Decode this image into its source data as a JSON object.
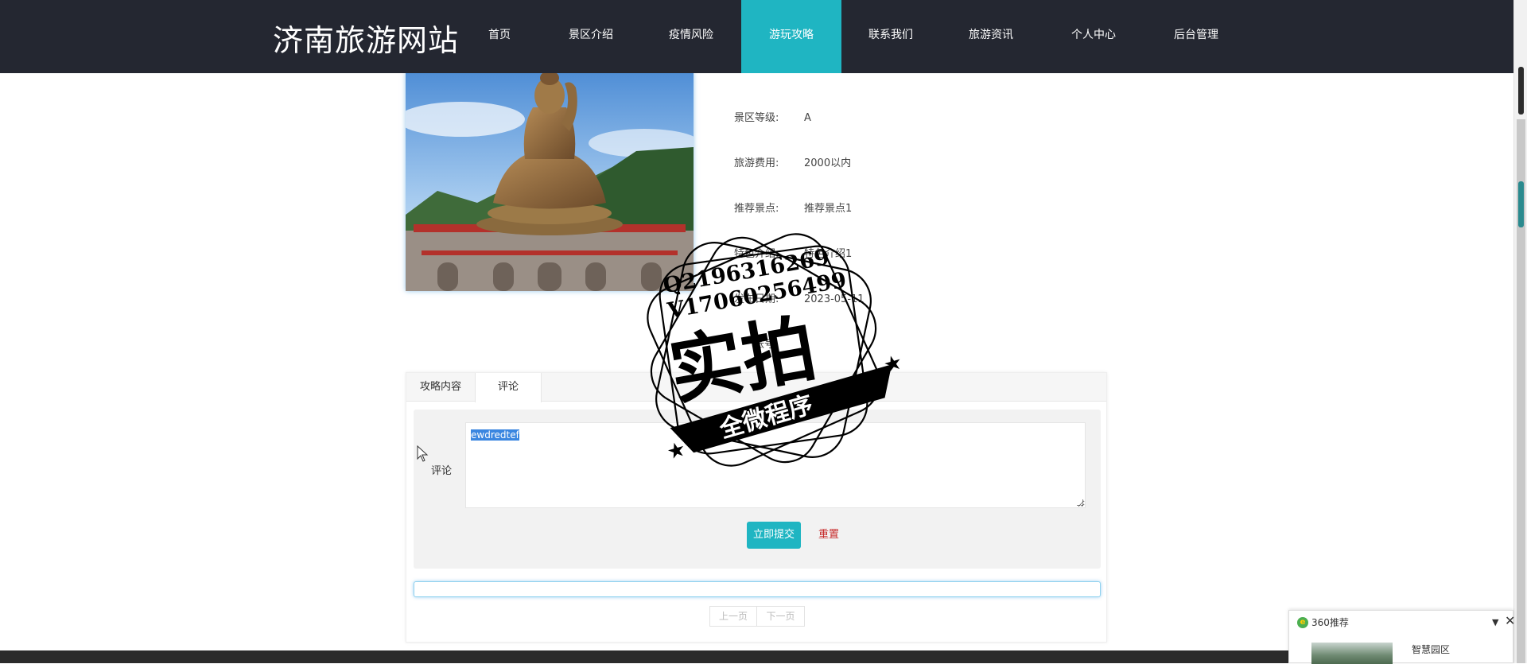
{
  "site": {
    "title": "济南旅游网站"
  },
  "nav": {
    "items": [
      {
        "label": "首页"
      },
      {
        "label": "景区介绍"
      },
      {
        "label": "疫情风险"
      },
      {
        "label": "游玩攻略"
      },
      {
        "label": "联系我们"
      },
      {
        "label": "旅游资讯"
      },
      {
        "label": "个人中心"
      },
      {
        "label": "后台管理"
      }
    ],
    "active": "游玩攻略"
  },
  "details": {
    "rows": [
      {
        "label": "景区等级:",
        "value": "A"
      },
      {
        "label": "旅游费用:",
        "value": "2000以内"
      },
      {
        "label": "推荐景点:",
        "value": "推荐景点1"
      },
      {
        "label": "特色介绍:",
        "value": "特色介绍1"
      },
      {
        "label": "发布日期:",
        "value": "2023-05-11"
      },
      {
        "label": "账号:",
        "value": ""
      }
    ]
  },
  "tabs": [
    {
      "label": "攻略内容"
    },
    {
      "label": "评论"
    }
  ],
  "comment_form": {
    "label": "评论",
    "value": "ewdredtef",
    "submit_label": "立即提交",
    "reset_label": "重置"
  },
  "pager": {
    "prev_label": "上一页",
    "next_label": "下一页"
  },
  "watermark": {
    "line1": "Q2196316269",
    "line2": "V17060256499",
    "big_text": "实拍",
    "banner_text": "全微程序"
  },
  "popup": {
    "title": "360推荐",
    "item": "智慧园区"
  },
  "colors": {
    "header_bg": "#242731",
    "accent": "#1fb5c2",
    "reset": "#c62828"
  }
}
